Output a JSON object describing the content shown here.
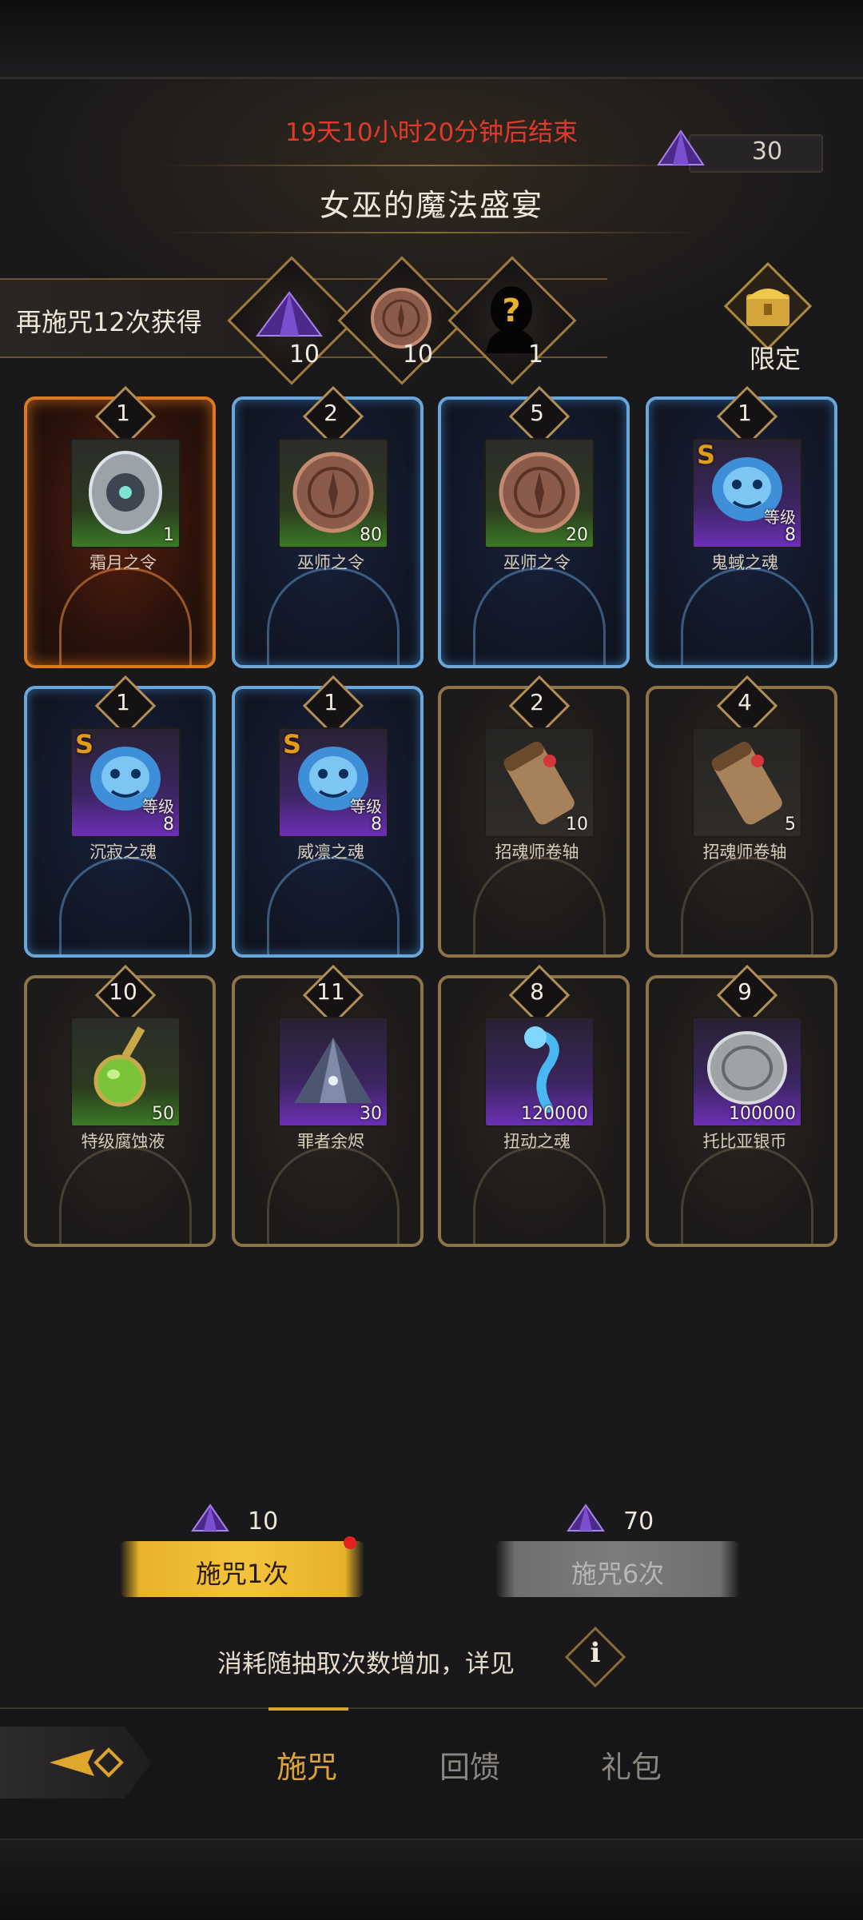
{
  "header": {
    "timer": "19天10小时20分钟后结束",
    "title": "女巫的魔法盛宴",
    "currency": {
      "icon": "purple-crystal-icon",
      "value": "30"
    }
  },
  "banner": {
    "text": "再施咒12次获得",
    "rewards": [
      {
        "icon": "purple-crystal-icon",
        "count": "10"
      },
      {
        "icon": "bronze-coin-icon",
        "count": "10"
      },
      {
        "icon": "mystery-silhouette-icon",
        "count": "1"
      }
    ],
    "chest_label": "限定"
  },
  "cards": [
    {
      "badge": "1",
      "name": "霜月之令",
      "qty": "1",
      "level": "",
      "frame": "orange",
      "rarity": "green",
      "icon": "silver-token-icon"
    },
    {
      "badge": "2",
      "name": "巫师之令",
      "qty": "80",
      "level": "",
      "frame": "blue",
      "rarity": "green",
      "icon": "bronze-coin-icon"
    },
    {
      "badge": "5",
      "name": "巫师之令",
      "qty": "20",
      "level": "",
      "frame": "blue",
      "rarity": "green",
      "icon": "bronze-coin-icon"
    },
    {
      "badge": "1",
      "name": "鬼蜮之魂",
      "qty": "8",
      "level": "等级",
      "frame": "blue",
      "rarity": "purple",
      "icon": "blue-spirit-icon"
    },
    {
      "badge": "1",
      "name": "沉寂之魂",
      "qty": "8",
      "level": "等级",
      "frame": "blue",
      "rarity": "purple",
      "icon": "blue-spirit-icon"
    },
    {
      "badge": "1",
      "name": "威凛之魂",
      "qty": "8",
      "level": "等级",
      "frame": "blue",
      "rarity": "purple",
      "icon": "blue-spirit-icon"
    },
    {
      "badge": "2",
      "name": "招魂师卷轴",
      "qty": "10",
      "level": "",
      "frame": "gold",
      "rarity": "gray",
      "icon": "scroll-icon"
    },
    {
      "badge": "4",
      "name": "招魂师卷轴",
      "qty": "5",
      "level": "",
      "frame": "gold",
      "rarity": "gray",
      "icon": "scroll-icon"
    },
    {
      "badge": "10",
      "name": "特级腐蚀液",
      "qty": "50",
      "level": "",
      "frame": "gold",
      "rarity": "green",
      "icon": "potion-icon"
    },
    {
      "badge": "11",
      "name": "罪者余烬",
      "qty": "30",
      "level": "",
      "frame": "gold",
      "rarity": "purple",
      "icon": "ember-crystal-icon"
    },
    {
      "badge": "8",
      "name": "扭动之魂",
      "qty": "120000",
      "level": "",
      "frame": "gold",
      "rarity": "purple",
      "icon": "wisp-icon"
    },
    {
      "badge": "9",
      "name": "托比亚银币",
      "qty": "100000",
      "level": "",
      "frame": "gold",
      "rarity": "purple",
      "icon": "silver-coin-icon"
    }
  ],
  "actions": {
    "single": {
      "cost": "10",
      "label": "施咒1次"
    },
    "multi": {
      "cost": "70",
      "label": "施咒6次"
    }
  },
  "note": "消耗随抽取次数增加，详见",
  "nav": {
    "tabs": [
      "施咒",
      "回馈",
      "礼包"
    ]
  },
  "colors": {
    "accent": "#f3c43a",
    "timer": "#e03a2c",
    "active_tab": "#d9a23a"
  }
}
